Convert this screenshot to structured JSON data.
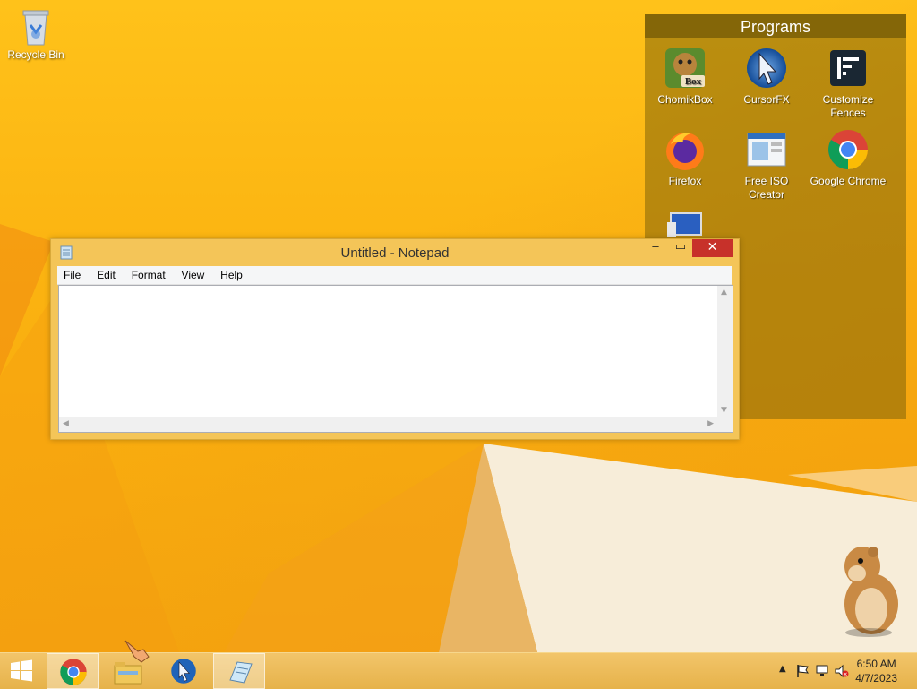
{
  "desktop": {
    "icons": [
      {
        "label": "Recycle Bin",
        "icon": "recycle-bin-icon"
      }
    ]
  },
  "fence": {
    "title": "Programs",
    "items": [
      {
        "label": "ChomikBox",
        "icon": "chomikbox-icon"
      },
      {
        "label": "CursorFX",
        "icon": "cursorfx-icon"
      },
      {
        "label": "Customize Fences",
        "icon": "fences-icon"
      },
      {
        "label": "Firefox",
        "icon": "firefox-icon"
      },
      {
        "label": "Free ISO Creator",
        "icon": "free-iso-creator-icon"
      },
      {
        "label": "Google Chrome",
        "icon": "chrome-icon"
      },
      {
        "label": "",
        "icon": "monitor-icon"
      }
    ]
  },
  "notepad": {
    "title": "Untitled - Notepad",
    "menu": [
      "File",
      "Edit",
      "Format",
      "View",
      "Help"
    ],
    "content": "",
    "controls": {
      "minimize": "‒",
      "maximize": "▭",
      "close": "✕"
    }
  },
  "taskbar": {
    "pinned": [
      {
        "name": "start",
        "icon": "windows-logo-icon"
      },
      {
        "name": "chrome",
        "icon": "chrome-icon",
        "active": true
      },
      {
        "name": "file-explorer",
        "icon": "file-explorer-icon"
      },
      {
        "name": "cursorfx",
        "icon": "cursorfx-icon"
      },
      {
        "name": "notepad",
        "icon": "notepad-icon",
        "active": true
      }
    ],
    "tray": {
      "time": "6:50 AM",
      "date": "4/7/2023",
      "icons": [
        "show-hidden-icons-chevron",
        "action-center-flag-icon",
        "network-icon",
        "volume-muted-icon"
      ]
    }
  },
  "colors": {
    "wallpaper": "#fbb210",
    "fence_bg": "#82640a",
    "close_button": "#c7312a",
    "taskbar": "#eab751"
  }
}
